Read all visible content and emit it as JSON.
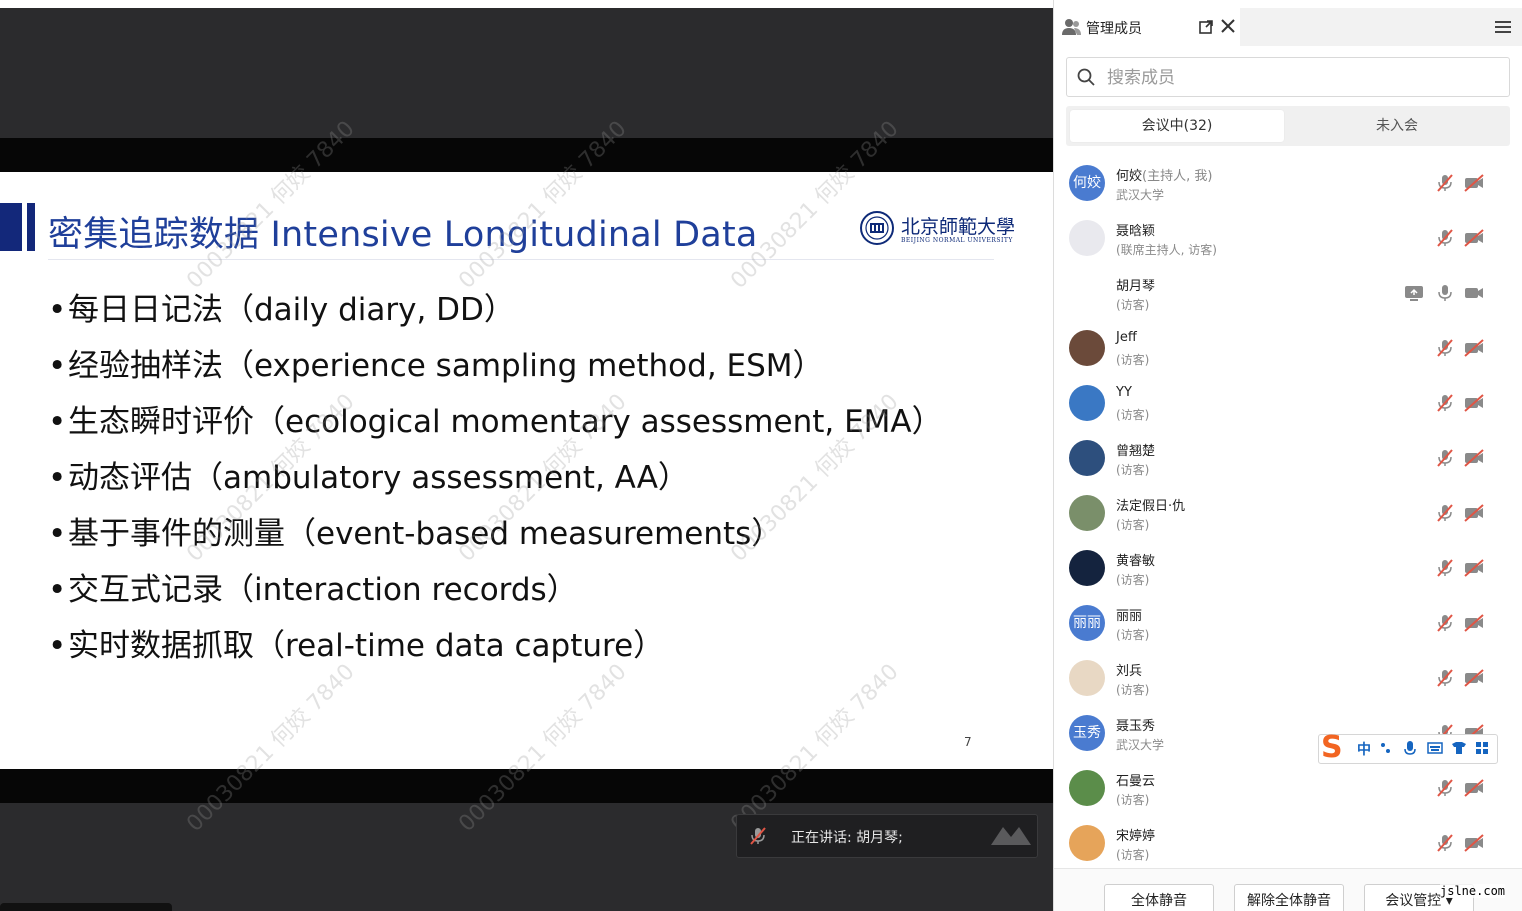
{
  "slide": {
    "title": "密集追踪数据 Intensive Longitudinal Data",
    "logo_text": "北京師範大學",
    "logo_subtext": "BEIJING NORMAL UNIVERSITY",
    "bullets": [
      "每日日记法（daily diary, DD）",
      "经验抽样法（experience sampling method, ESM）",
      "生态瞬时评价（ecological momentary assessment, EMA）",
      "动态评估（ambulatory assessment, AA）",
      "基于事件的测量（event-based measurements）",
      "交互式记录（interaction records）",
      "实时数据抓取（real-time data capture）"
    ],
    "page_number": "7",
    "watermark": "00030821 何姣 7840"
  },
  "speaking": {
    "label": "正在讲话:  胡月琴;"
  },
  "panel": {
    "title": "管理成员",
    "search_placeholder": "搜索成员",
    "tabs": {
      "in_meeting": "会议中(32)",
      "not_joined": "未入会"
    },
    "members": [
      {
        "name": "何姣",
        "role": "(主持人, 我)",
        "sub": "武汉大学",
        "avatar_text": "何姣",
        "avatar_color": "#4a7bd0",
        "mic": "muted",
        "cam": "off"
      },
      {
        "name": "聂晗颖",
        "role": "",
        "sub": "(联席主持人, 访客)",
        "avatar_text": "",
        "avatar_color": "#e9e9ee",
        "mic": "muted",
        "cam": "off"
      },
      {
        "name": "胡月琴",
        "role": "",
        "sub": "(访客)",
        "avatar_text": "",
        "avatar_color": "#ffffff",
        "mic": "on",
        "cam": "on",
        "sharing": true
      },
      {
        "name": "Jeff",
        "role": "",
        "sub": "(访客)",
        "avatar_text": "",
        "avatar_color": "#6b4a3a",
        "mic": "muted",
        "cam": "off"
      },
      {
        "name": "YY",
        "role": "",
        "sub": "(访客)",
        "avatar_text": "",
        "avatar_color": "#3a78c4",
        "mic": "muted",
        "cam": "off"
      },
      {
        "name": "曾翘楚",
        "role": "",
        "sub": "(访客)",
        "avatar_text": "",
        "avatar_color": "#2d4f7d",
        "mic": "muted",
        "cam": "off"
      },
      {
        "name": "法定假日·仇",
        "role": "",
        "sub": "(访客)",
        "avatar_text": "",
        "avatar_color": "#7a8f6a",
        "mic": "muted",
        "cam": "off"
      },
      {
        "name": "黄睿敏",
        "role": "",
        "sub": "(访客)",
        "avatar_text": "",
        "avatar_color": "#14233e",
        "mic": "muted",
        "cam": "off"
      },
      {
        "name": "丽丽",
        "role": "",
        "sub": "(访客)",
        "avatar_text": "丽丽",
        "avatar_color": "#4a7bd0",
        "mic": "muted",
        "cam": "off"
      },
      {
        "name": "刘兵",
        "role": "",
        "sub": "(访客)",
        "avatar_text": "",
        "avatar_color": "#e8d8c4",
        "mic": "muted",
        "cam": "off"
      },
      {
        "name": "聂玉秀",
        "role": "",
        "sub": "武汉大学",
        "avatar_text": "玉秀",
        "avatar_color": "#4a7bd0",
        "mic": "muted",
        "cam": "off"
      },
      {
        "name": "石曼云",
        "role": "",
        "sub": "(访客)",
        "avatar_text": "",
        "avatar_color": "#5b8d4a",
        "mic": "muted",
        "cam": "off"
      },
      {
        "name": "宋婷婷",
        "role": "",
        "sub": "(访客)",
        "avatar_text": "",
        "avatar_color": "#e6a45a",
        "mic": "muted",
        "cam": "off"
      }
    ],
    "footer": {
      "mute_all": "全体静音",
      "unmute_all": "解除全体静音",
      "manage": "会议管控"
    }
  },
  "ime": {
    "lang": "中"
  },
  "site_mark": "jslne.com",
  "colors": {
    "muted_red": "#e05545",
    "icon_grey": "#8a8a8a",
    "accent_blue": "#4a7bd0"
  }
}
